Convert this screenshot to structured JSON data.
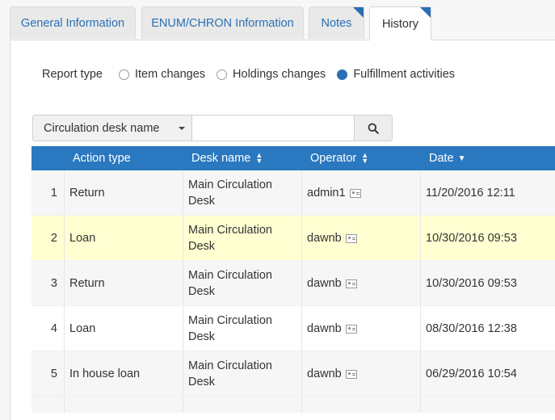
{
  "tabs": [
    {
      "label": "General Information",
      "active": false,
      "marked": false
    },
    {
      "label": "ENUM/CHRON Information",
      "active": false,
      "marked": false
    },
    {
      "label": "Notes",
      "active": false,
      "marked": true
    },
    {
      "label": "History",
      "active": true,
      "marked": true
    }
  ],
  "report": {
    "label": "Report type",
    "options": [
      {
        "label": "Item changes",
        "selected": false
      },
      {
        "label": "Holdings changes",
        "selected": false
      },
      {
        "label": "Fulfillment activities",
        "selected": true
      }
    ]
  },
  "search": {
    "field": "Circulation desk name",
    "value": "",
    "placeholder": ""
  },
  "table": {
    "headers": {
      "action_type": "Action type",
      "desk_name": "Desk name",
      "operator": "Operator",
      "date": "Date"
    },
    "rows": [
      {
        "num": "1",
        "action": "Return",
        "desk_line1": "Main Circulation",
        "desk_line2": "Desk",
        "operator": "admin1",
        "date": "11/20/2016 12:11",
        "highlight": false
      },
      {
        "num": "2",
        "action": "Loan",
        "desk_line1": "Main Circulation",
        "desk_line2": "Desk",
        "operator": "dawnb",
        "date": "10/30/2016 09:53",
        "highlight": true
      },
      {
        "num": "3",
        "action": "Return",
        "desk_line1": "Main Circulation",
        "desk_line2": "Desk",
        "operator": "dawnb",
        "date": "10/30/2016 09:53",
        "highlight": false
      },
      {
        "num": "4",
        "action": "Loan",
        "desk_line1": "Main Circulation",
        "desk_line2": "Desk",
        "operator": "dawnb",
        "date": "08/30/2016 12:38",
        "highlight": false
      },
      {
        "num": "5",
        "action": "In house loan",
        "desk_line1": "Main Circulation",
        "desk_line2": "Desk",
        "operator": "dawnb",
        "date": "06/29/2016 10:54",
        "highlight": false
      }
    ]
  },
  "colors": {
    "accent": "#2a78bf",
    "highlight": "#ffffd2",
    "link": "#2a6fb4"
  }
}
